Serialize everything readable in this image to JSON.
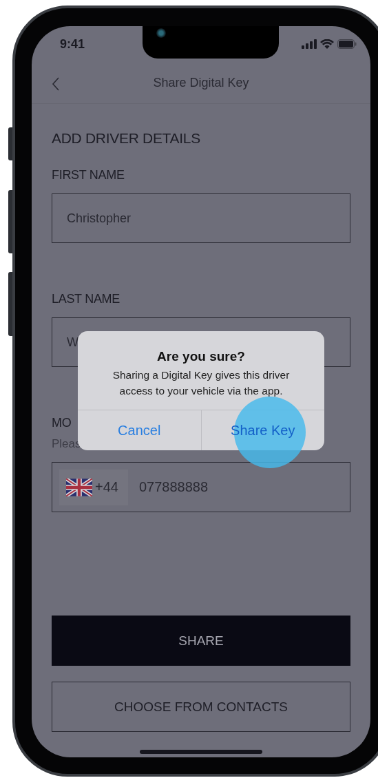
{
  "status_bar": {
    "time": "9:41"
  },
  "nav": {
    "title": "Share Digital Key"
  },
  "form": {
    "heading": "ADD DRIVER DETAILS",
    "fields": [
      {
        "label": "FIRST NAME",
        "value": "Christopher"
      },
      {
        "label": "LAST NAME",
        "value": "W"
      }
    ],
    "mobile": {
      "label": "MO",
      "hint": "Pleas",
      "country_code": "+44",
      "value": "077888888"
    }
  },
  "buttons": [
    {
      "label": "SHARE",
      "kind": "primary"
    },
    {
      "label": "CHOOSE FROM CONTACTS",
      "kind": "secondary"
    }
  ],
  "dialog": {
    "title": "Are you sure?",
    "message": "Sharing a Digital Key gives this driver access to your vehicle via the app.",
    "actions": [
      {
        "label": "Cancel"
      },
      {
        "label": "Share Key"
      }
    ]
  }
}
